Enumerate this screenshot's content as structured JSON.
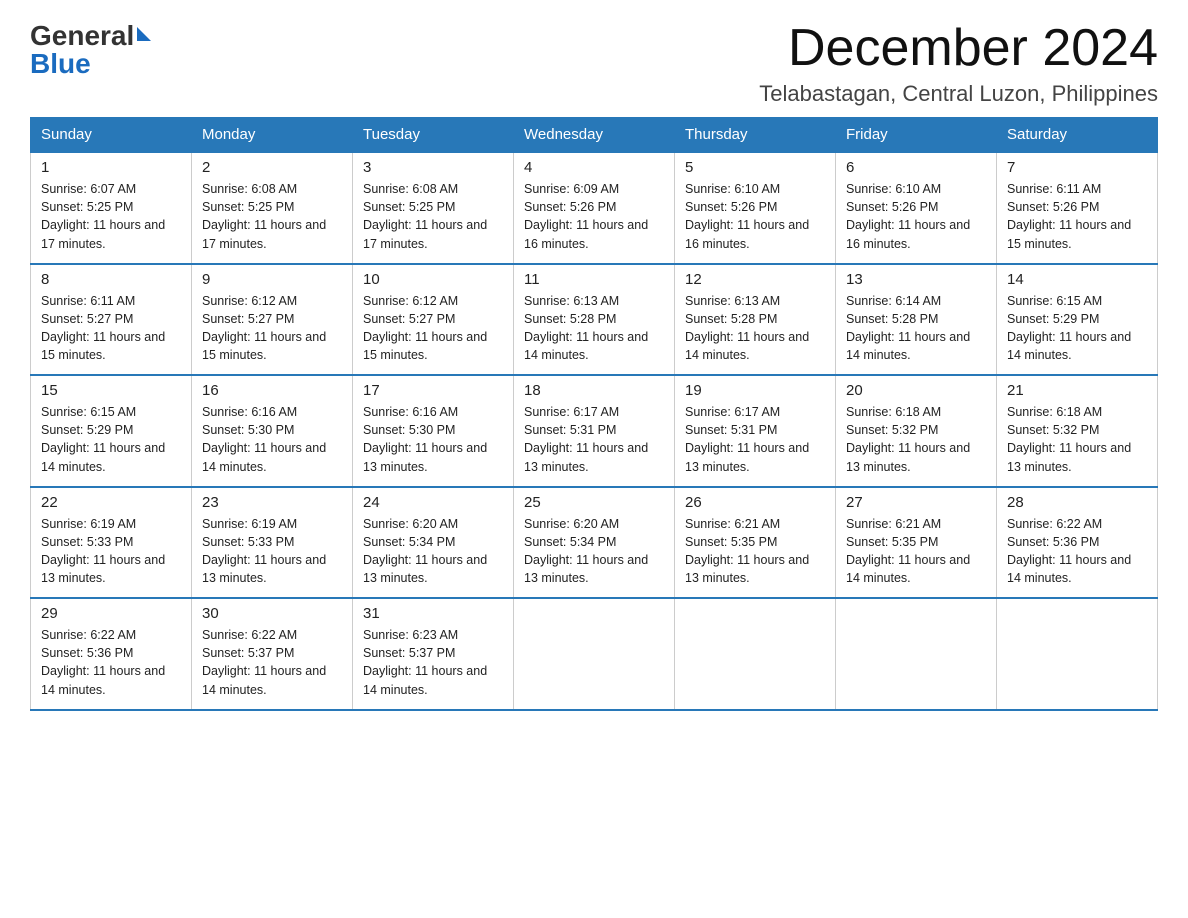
{
  "header": {
    "logo_general": "General",
    "logo_blue": "Blue",
    "month_title": "December 2024",
    "location": "Telabastagan, Central Luzon, Philippines"
  },
  "weekdays": [
    "Sunday",
    "Monday",
    "Tuesday",
    "Wednesday",
    "Thursday",
    "Friday",
    "Saturday"
  ],
  "weeks": [
    [
      {
        "day": "1",
        "sunrise": "6:07 AM",
        "sunset": "5:25 PM",
        "daylight": "11 hours and 17 minutes."
      },
      {
        "day": "2",
        "sunrise": "6:08 AM",
        "sunset": "5:25 PM",
        "daylight": "11 hours and 17 minutes."
      },
      {
        "day": "3",
        "sunrise": "6:08 AM",
        "sunset": "5:25 PM",
        "daylight": "11 hours and 17 minutes."
      },
      {
        "day": "4",
        "sunrise": "6:09 AM",
        "sunset": "5:26 PM",
        "daylight": "11 hours and 16 minutes."
      },
      {
        "day": "5",
        "sunrise": "6:10 AM",
        "sunset": "5:26 PM",
        "daylight": "11 hours and 16 minutes."
      },
      {
        "day": "6",
        "sunrise": "6:10 AM",
        "sunset": "5:26 PM",
        "daylight": "11 hours and 16 minutes."
      },
      {
        "day": "7",
        "sunrise": "6:11 AM",
        "sunset": "5:26 PM",
        "daylight": "11 hours and 15 minutes."
      }
    ],
    [
      {
        "day": "8",
        "sunrise": "6:11 AM",
        "sunset": "5:27 PM",
        "daylight": "11 hours and 15 minutes."
      },
      {
        "day": "9",
        "sunrise": "6:12 AM",
        "sunset": "5:27 PM",
        "daylight": "11 hours and 15 minutes."
      },
      {
        "day": "10",
        "sunrise": "6:12 AM",
        "sunset": "5:27 PM",
        "daylight": "11 hours and 15 minutes."
      },
      {
        "day": "11",
        "sunrise": "6:13 AM",
        "sunset": "5:28 PM",
        "daylight": "11 hours and 14 minutes."
      },
      {
        "day": "12",
        "sunrise": "6:13 AM",
        "sunset": "5:28 PM",
        "daylight": "11 hours and 14 minutes."
      },
      {
        "day": "13",
        "sunrise": "6:14 AM",
        "sunset": "5:28 PM",
        "daylight": "11 hours and 14 minutes."
      },
      {
        "day": "14",
        "sunrise": "6:15 AM",
        "sunset": "5:29 PM",
        "daylight": "11 hours and 14 minutes."
      }
    ],
    [
      {
        "day": "15",
        "sunrise": "6:15 AM",
        "sunset": "5:29 PM",
        "daylight": "11 hours and 14 minutes."
      },
      {
        "day": "16",
        "sunrise": "6:16 AM",
        "sunset": "5:30 PM",
        "daylight": "11 hours and 14 minutes."
      },
      {
        "day": "17",
        "sunrise": "6:16 AM",
        "sunset": "5:30 PM",
        "daylight": "11 hours and 13 minutes."
      },
      {
        "day": "18",
        "sunrise": "6:17 AM",
        "sunset": "5:31 PM",
        "daylight": "11 hours and 13 minutes."
      },
      {
        "day": "19",
        "sunrise": "6:17 AM",
        "sunset": "5:31 PM",
        "daylight": "11 hours and 13 minutes."
      },
      {
        "day": "20",
        "sunrise": "6:18 AM",
        "sunset": "5:32 PM",
        "daylight": "11 hours and 13 minutes."
      },
      {
        "day": "21",
        "sunrise": "6:18 AM",
        "sunset": "5:32 PM",
        "daylight": "11 hours and 13 minutes."
      }
    ],
    [
      {
        "day": "22",
        "sunrise": "6:19 AM",
        "sunset": "5:33 PM",
        "daylight": "11 hours and 13 minutes."
      },
      {
        "day": "23",
        "sunrise": "6:19 AM",
        "sunset": "5:33 PM",
        "daylight": "11 hours and 13 minutes."
      },
      {
        "day": "24",
        "sunrise": "6:20 AM",
        "sunset": "5:34 PM",
        "daylight": "11 hours and 13 minutes."
      },
      {
        "day": "25",
        "sunrise": "6:20 AM",
        "sunset": "5:34 PM",
        "daylight": "11 hours and 13 minutes."
      },
      {
        "day": "26",
        "sunrise": "6:21 AM",
        "sunset": "5:35 PM",
        "daylight": "11 hours and 13 minutes."
      },
      {
        "day": "27",
        "sunrise": "6:21 AM",
        "sunset": "5:35 PM",
        "daylight": "11 hours and 14 minutes."
      },
      {
        "day": "28",
        "sunrise": "6:22 AM",
        "sunset": "5:36 PM",
        "daylight": "11 hours and 14 minutes."
      }
    ],
    [
      {
        "day": "29",
        "sunrise": "6:22 AM",
        "sunset": "5:36 PM",
        "daylight": "11 hours and 14 minutes."
      },
      {
        "day": "30",
        "sunrise": "6:22 AM",
        "sunset": "5:37 PM",
        "daylight": "11 hours and 14 minutes."
      },
      {
        "day": "31",
        "sunrise": "6:23 AM",
        "sunset": "5:37 PM",
        "daylight": "11 hours and 14 minutes."
      },
      null,
      null,
      null,
      null
    ]
  ],
  "labels": {
    "sunrise_prefix": "Sunrise: ",
    "sunset_prefix": "Sunset: ",
    "daylight_prefix": "Daylight: "
  }
}
